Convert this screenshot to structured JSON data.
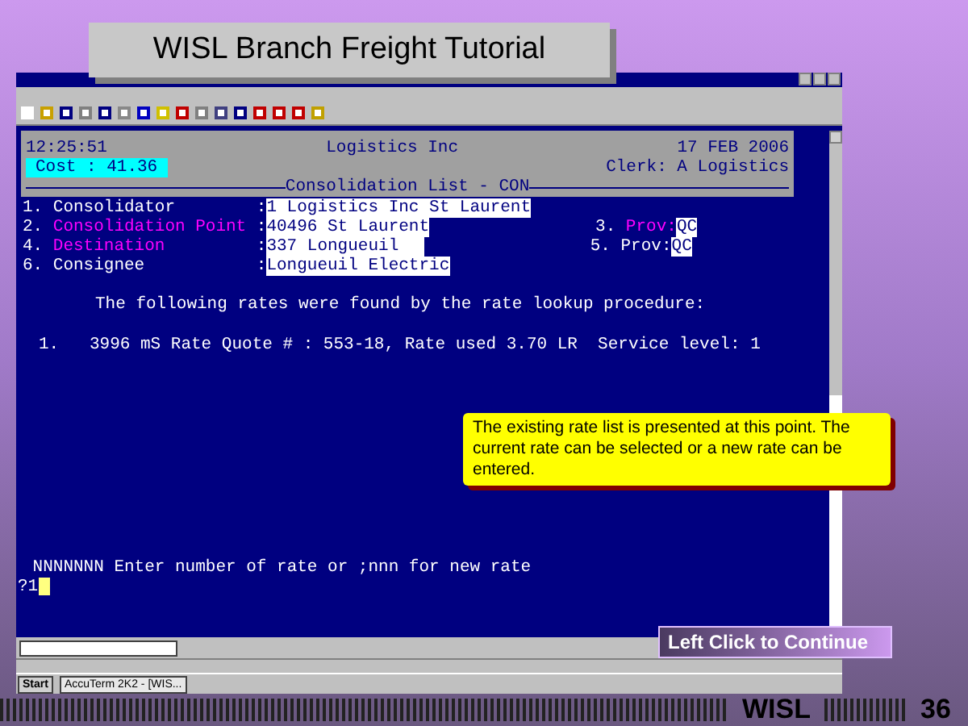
{
  "slide": {
    "title": "WISL Branch Freight Tutorial",
    "footer": "WISL",
    "page": "36"
  },
  "terminal": {
    "time": "12:25:51",
    "company": "Logistics Inc",
    "date": "17 FEB 2006",
    "cost": "Cost : 41.36",
    "clerk": "Clerk: A Logistics",
    "screen_title": "Consolidation List - CON",
    "fields": [
      {
        "number": "1.",
        "label": "Consolidator",
        "color": "#ffffff",
        "value": "1 Logistics Inc St Laurent"
      },
      {
        "number": "2.",
        "label": "Consolidation Point",
        "color": "#ff00ff",
        "value": "40496 St Laurent",
        "prov": {
          "number": "3.",
          "label": "Prov:",
          "color": "#ff00ff",
          "value": "QC"
        }
      },
      {
        "number": "4.",
        "label": "Destination",
        "color": "#ff00ff",
        "value": "337 Longueuil",
        "prov": {
          "number": "5.",
          "label": "Prov:",
          "color": "#ffffff",
          "value": "QC"
        }
      },
      {
        "number": "6.",
        "label": "Consignee",
        "color": "#ffffff",
        "value": "Longueuil Electric"
      }
    ],
    "message": "The following rates were found by the rate lookup procedure:",
    "rates": [
      {
        "number": "1.",
        "text": "3996 mS Rate Quote # : 553-18, Rate used 3.70 LR  Service level: 1"
      }
    ],
    "separator": ":",
    "prompt": "NNNNNNN Enter number of rate or ;nnn for new rate",
    "input": "?1"
  },
  "callout": "The existing rate list is presented at this point. The current rate can be selected or a new rate can be entered.",
  "continue_button": "Left Click to Continue",
  "taskbar": {
    "start": "Start",
    "tasks": [
      {
        "label": "AccuTerm 2K2 - [WIS...",
        "selected": true
      }
    ]
  }
}
